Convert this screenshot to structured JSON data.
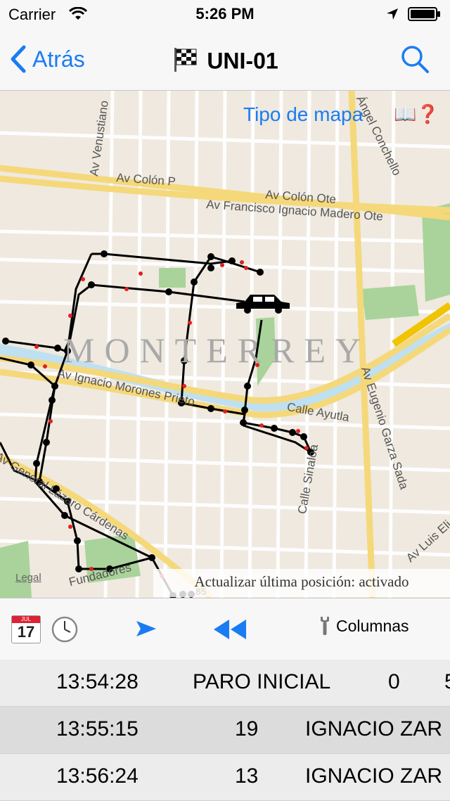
{
  "status": {
    "carrier": "Carrier",
    "time": "5:26 PM"
  },
  "nav": {
    "back_label": "Atrás",
    "title": "UNI-01"
  },
  "map": {
    "tipo_mapa_label": "Tipo de mapa",
    "help_icon": "📖❓",
    "legal_label": "Legal",
    "city_label": "MONTERREY",
    "update_banner": "Actualizar última posición: activado",
    "street_labels": [
      "Av Venustiano",
      "Av Colón P",
      "Av Colón Ote",
      "Av Francisco Ignacio Madero Ote",
      "Ángel Conchello",
      "Av Ignacio Morones Prieto",
      "Calle Ayutla",
      "Av Eugenio Garza Sada",
      "Calle Sinaloa",
      "Av General Lázaro Cárdenas",
      "Av Luis Eli",
      "Fundadores",
      "85"
    ],
    "colors": {
      "route": "#000000",
      "route_points": "#e02020",
      "major_road": "#f5d87a",
      "park": "#a9d39a",
      "river": "#bfe0f0"
    }
  },
  "toolbar": {
    "calendar_month": "JUL",
    "calendar_day": "17",
    "columnas_label": "Columnas"
  },
  "table": {
    "rows": [
      {
        "time": "13:54:28",
        "event": "PARO INICIAL",
        "value": "0",
        "extra": "5"
      },
      {
        "time": "13:55:15",
        "speed": "19",
        "address": "IGNACIO ZAR"
      },
      {
        "time": "13:56:24",
        "speed": "13",
        "address": "IGNACIO ZAR"
      }
    ]
  }
}
